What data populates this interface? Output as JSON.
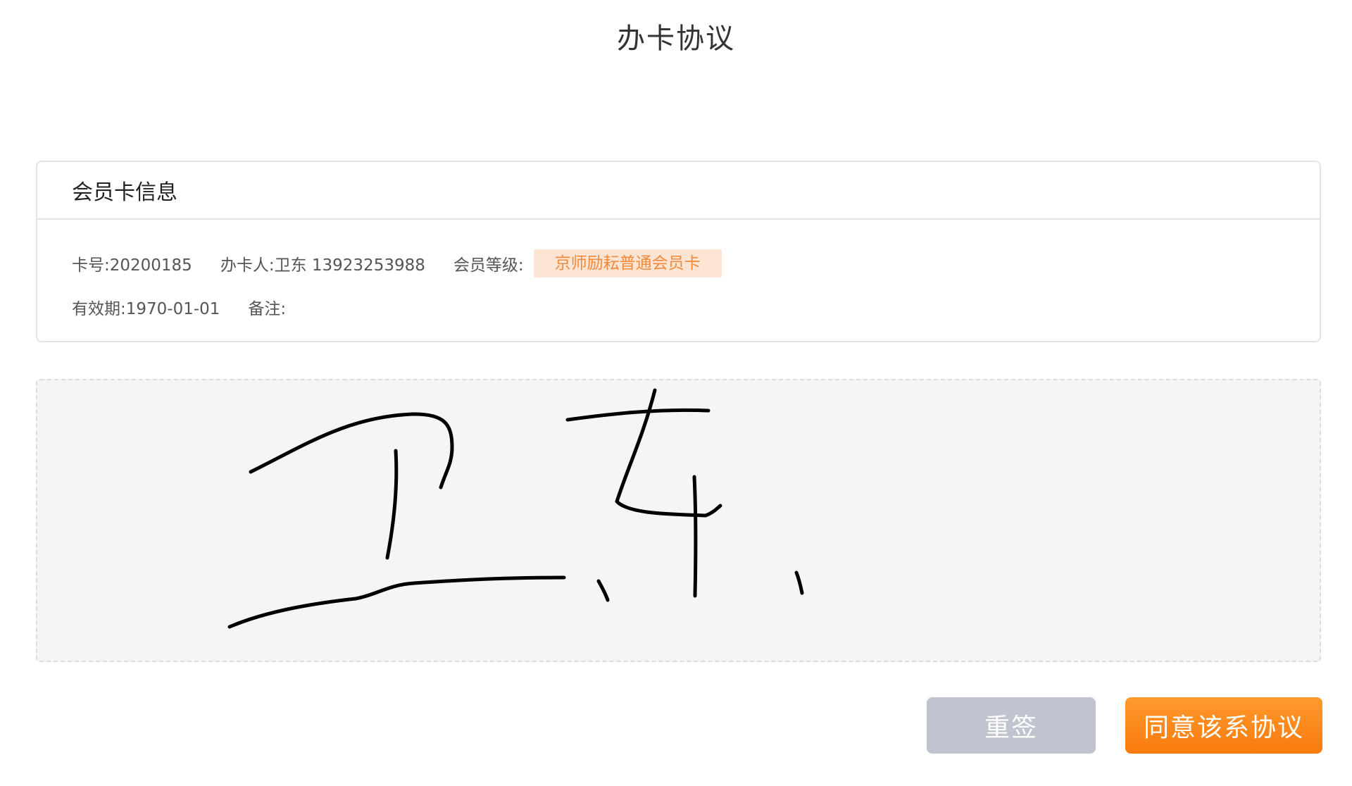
{
  "page": {
    "title": "办卡协议"
  },
  "card_info": {
    "header": "会员卡信息",
    "card_no": "卡号:20200185",
    "holder": "办卡人:卫东 13923253988",
    "level_label": "会员等级:",
    "level_value": "京师励耘普通会员卡",
    "validity": "有效期:1970-01-01",
    "remark": "备注:"
  },
  "signature": {
    "content": "卫东",
    "ink_color": "#000000",
    "pad_color": "#f6f4f6"
  },
  "actions": {
    "reset_label": "重签",
    "agree_label": "同意该系协议"
  },
  "colors": {
    "accent": "#f77a0e",
    "badge_bg": "#fde4d3",
    "badge_text": "#f08a3c",
    "reset_bg": "#c0c4cf"
  }
}
